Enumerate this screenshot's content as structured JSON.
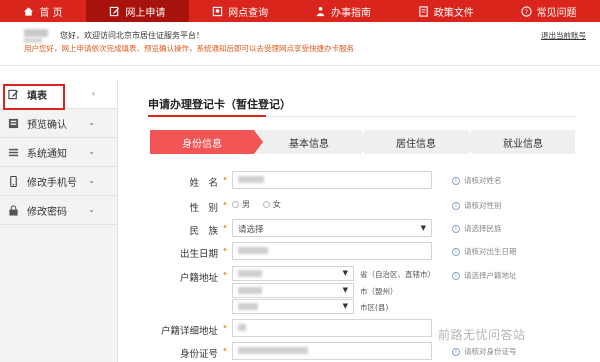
{
  "nav": {
    "items": [
      {
        "label": "首 页",
        "icon": "home-icon"
      },
      {
        "label": "网上申请",
        "icon": "edit-icon",
        "active": true
      },
      {
        "label": "网点查询",
        "icon": "location-icon"
      },
      {
        "label": "办事指南",
        "icon": "guide-icon"
      },
      {
        "label": "政策文件",
        "icon": "document-icon"
      },
      {
        "label": "常见问题",
        "icon": "help-icon"
      }
    ]
  },
  "userbar": {
    "welcome": "您好，欢迎访问北京市居住证服务平台！",
    "notice": "用户您好，网上申请依次完成填表、预览确认操作，系统通知后即可以去受理网点享受快捷办卡服务",
    "logout": "退出当前账号"
  },
  "sidebar": {
    "items": [
      {
        "label": "填表",
        "icon": "edit-icon"
      },
      {
        "label": "预览确认",
        "icon": "preview-icon"
      },
      {
        "label": "系统通知",
        "icon": "list-icon"
      },
      {
        "label": "修改手机号",
        "icon": "phone-icon"
      },
      {
        "label": "修改密码",
        "icon": "lock-icon"
      }
    ]
  },
  "form": {
    "title": "申请办理登记卡（暂住登记）",
    "steps": [
      "身份信息",
      "基本信息",
      "居住信息",
      "就业信息"
    ],
    "fields": {
      "name": {
        "label": "姓　名",
        "hint": "请核对姓名"
      },
      "gender": {
        "label": "性　别",
        "options": [
          "男",
          "女"
        ],
        "hint": "请核对性别"
      },
      "ethnicity": {
        "label": "民　族",
        "value": "请选择",
        "hint": "请选择民族"
      },
      "birthdate": {
        "label": "出生日期",
        "hint": "请核对出生日期"
      },
      "household": {
        "label": "户籍地址",
        "hint": "请选择户籍地址",
        "unit_province": "省（自治区、直辖市）",
        "unit_city": "市（盟州）",
        "unit_county": "市区(县)"
      },
      "household_detail": {
        "label": "户籍详细地址"
      },
      "id_number": {
        "label": "身份证号",
        "hint": "请核对身份证号"
      }
    }
  },
  "watermark": "前路无忧问答站"
}
